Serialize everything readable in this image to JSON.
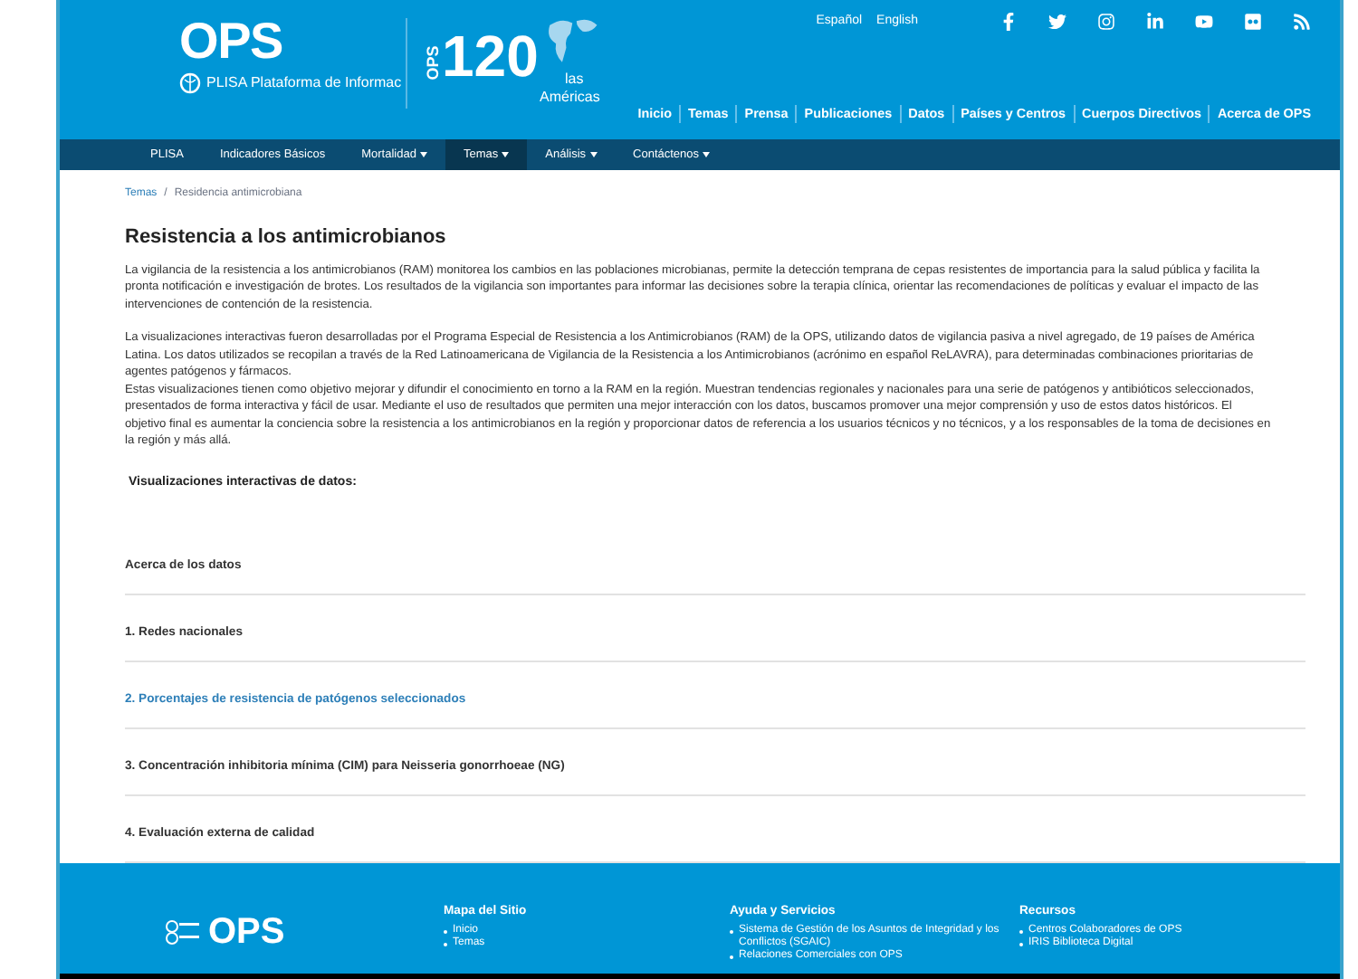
{
  "header": {
    "logo": "OPS",
    "subtitle": "PLISA Plataforma de Informac",
    "subtitle_end": [
      "las",
      "Américas"
    ],
    "anniversary": {
      "letters": "OPS",
      "number": "120"
    },
    "languages": [
      "Español",
      "English"
    ],
    "top_nav": [
      "Inicio",
      "Temas",
      "Prensa",
      "Publicaciones",
      "Datos",
      "Países y Centros",
      "Cuerpos Directivos",
      "Acerca de OPS"
    ]
  },
  "nav": [
    {
      "label": "PLISA",
      "dropdown": false,
      "selected": false
    },
    {
      "label": "Indicadores Básicos",
      "dropdown": false,
      "selected": false
    },
    {
      "label": "Mortalidad",
      "dropdown": true,
      "selected": false
    },
    {
      "label": "Temas",
      "dropdown": true,
      "selected": true
    },
    {
      "label": "Análisis",
      "dropdown": true,
      "selected": false
    },
    {
      "label": "Contáctenos",
      "dropdown": true,
      "selected": false
    }
  ],
  "breadcrumb": [
    "Temas",
    "/",
    "Residencia antimicrobiana"
  ],
  "title": "Resistencia a los antimicrobianos",
  "paragraphs": [
    "La vigilancia de la resistencia a los antimicrobianos (RAM) monitorea los cambios en las poblaciones microbianas, permite la detección temprana de cepas resistentes de importancia para la salud pública y facilita la pronta notificación e investigación de brotes. Los resultados de la vigilancia son importantes para informar las decisiones sobre la terapia clínica, orientar las recomendaciones de políticas y evaluar el impacto de las intervenciones de contención de la resistencia.",
    "La visualizaciones interactivas fueron desarrolladas por el Programa Especial de Resistencia a los Antimicrobianos (RAM) de la OPS, utilizando datos de vigilancia pasiva a nivel agregado, de 19 países de América Latina. Los datos utilizados se recopilan a través de la Red Latinoamericana de Vigilancia de la Resistencia a los Antimicrobianos (acrónimo en español ReLAVRA), para determinadas combinaciones prioritarias de agentes patógenos y fármacos.",
    "Estas visualizaciones tienen como objetivo mejorar y difundir el conocimiento en torno a la RAM en la región. Muestran tendencias regionales y nacionales para una serie de patógenos y antibióticos seleccionados, presentados de forma interactiva y fácil de usar. Mediante el uso de resultados que permiten una mejor interacción con los datos, buscamos promover una mejor comprensión y uso de estos datos históricos. El objetivo final es aumentar la conciencia sobre la resistencia a los antimicrobianos en la región y proporcionar datos de referencia a los usuarios técnicos y no técnicos, y a los responsables de la toma de decisiones en la región y más allá."
  ],
  "section_heading": "Visualizaciones interactivas de datos:",
  "links": [
    {
      "label": "Acerca de los datos",
      "selected": false
    },
    {
      "label": "1. Redes nacionales",
      "selected": false
    },
    {
      "label": "2. Porcentajes de resistencia de patógenos seleccionados",
      "selected": true
    },
    {
      "label": "3. Concentración inhibitoria mínima (CIM) para Neisseria gonorrhoeae (NG)",
      "selected": false
    },
    {
      "label": "4. Evaluación externa de calidad",
      "selected": false
    }
  ],
  "footer": {
    "logo": "OPS",
    "columns": [
      {
        "title": "Mapa del Sitio",
        "items": [
          "Inicio",
          "Temas"
        ]
      },
      {
        "title": "Ayuda y Servicios",
        "items": [
          "Sistema de Gestión de los Asuntos de Integridad y los Conflictos (SGAIC)",
          "Relaciones Comerciales con OPS"
        ]
      },
      {
        "title": "Recursos",
        "items": [
          "Centros Colaboradores de OPS",
          "IRIS Biblioteca Digital"
        ]
      }
    ]
  }
}
